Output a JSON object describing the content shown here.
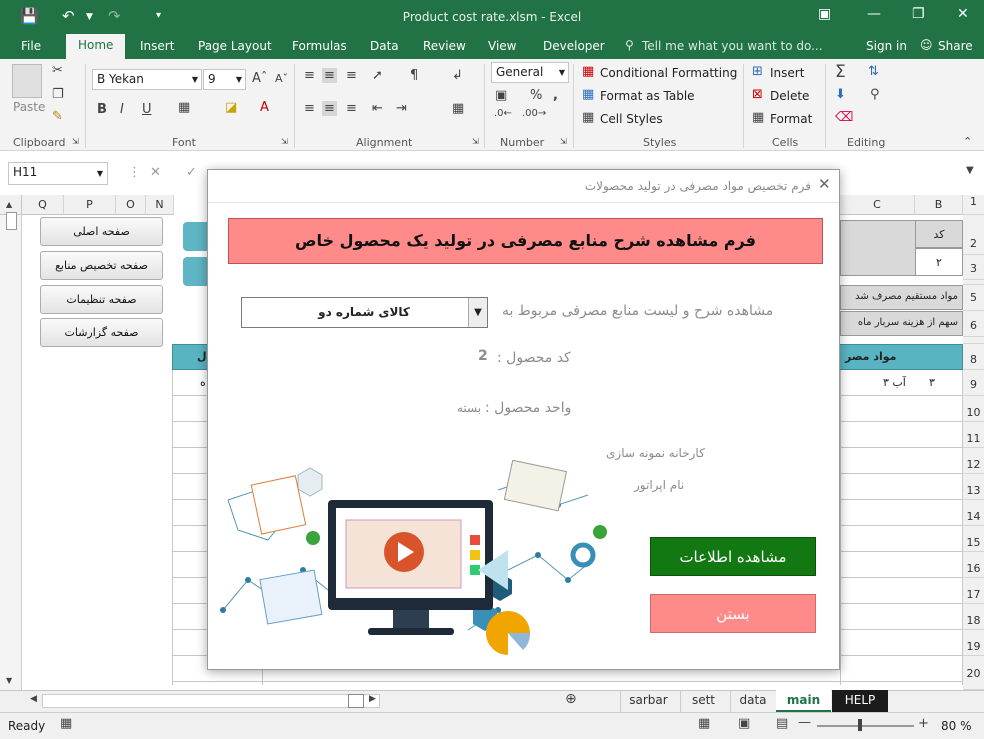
{
  "titlebar": {
    "title": "Product cost rate.xlsm - Excel"
  },
  "tabs": [
    "File",
    "Home",
    "Insert",
    "Page Layout",
    "Formulas",
    "Data",
    "Review",
    "View",
    "Developer"
  ],
  "tell_me": "Tell me what you want to do...",
  "sign_in": "Sign in",
  "share": "Share",
  "ribbon": {
    "paste": "Paste",
    "font_name": "B Yekan",
    "font_size": "9",
    "number_format": "General",
    "conditional_formatting": "Conditional Formatting",
    "format_as_table": "Format as Table",
    "cell_styles": "Cell Styles",
    "insert": "Insert",
    "delete": "Delete",
    "format": "Format",
    "groups": {
      "clipboard": "Clipboard",
      "font": "Font",
      "alignment": "Alignment",
      "number": "Number",
      "styles": "Styles",
      "cells": "Cells",
      "editing": "Editing"
    }
  },
  "formula_bar": {
    "name_box": "H11"
  },
  "sheet": {
    "col_headers_left": [
      "Q",
      "P",
      "O",
      "N"
    ],
    "col_headers_right": [
      "C",
      "B"
    ],
    "row_headers": [
      "1",
      "2",
      "3",
      "4",
      "5",
      "6",
      "7",
      "8",
      "9",
      "10",
      "11",
      "12",
      "13",
      "14",
      "15",
      "16",
      "17",
      "18",
      "19",
      "20"
    ],
    "nav_buttons": [
      "صفحه اصلی",
      "صفحه تخصیص منابع",
      "صفحه تنظیمات",
      "صفحه گزارشات"
    ],
    "cells": {
      "code_label": "کد",
      "code_value": "۲",
      "direct_usage": "مواد مستقیم مصرف شد",
      "overhead_share": "سهم از هزینه سربار ماه",
      "materials_header": "مواد مصر",
      "row9_num": "۳",
      "row9_name": "آب ۳",
      "left_fragment": "ه",
      "left_hdr_fragment": "ل"
    }
  },
  "dialog": {
    "title": "فرم تخصیص مواد مصرفی در تولید محصولات",
    "banner": "فرم مشاهده شرح منابع مصرفی در تولید یک محصول خاص",
    "select_label": "مشاهده شرح و لیست منابع مصرفی مربوط به",
    "selected_product": "کالای شماره دو",
    "product_code_label": "کد محصول :",
    "product_code_value": "2",
    "product_unit_label": "واحد محصول :",
    "product_unit_value": "بسته",
    "company": "کارخانه نمونه سازی",
    "operator": "نام اپراتور",
    "view_button": "مشاهده اطلاعات",
    "close_button": "بستن"
  },
  "sheet_tabs": [
    "sarbar",
    "sett",
    "data",
    "main",
    "HELP"
  ],
  "active_sheet": "main",
  "status": {
    "ready": "Ready",
    "zoom": "80 %"
  },
  "colors": {
    "excel_green": "#217346",
    "banner_pink": "#ff8a8a",
    "view_button_green": "#127812",
    "teal_header": "#59b4c2"
  }
}
